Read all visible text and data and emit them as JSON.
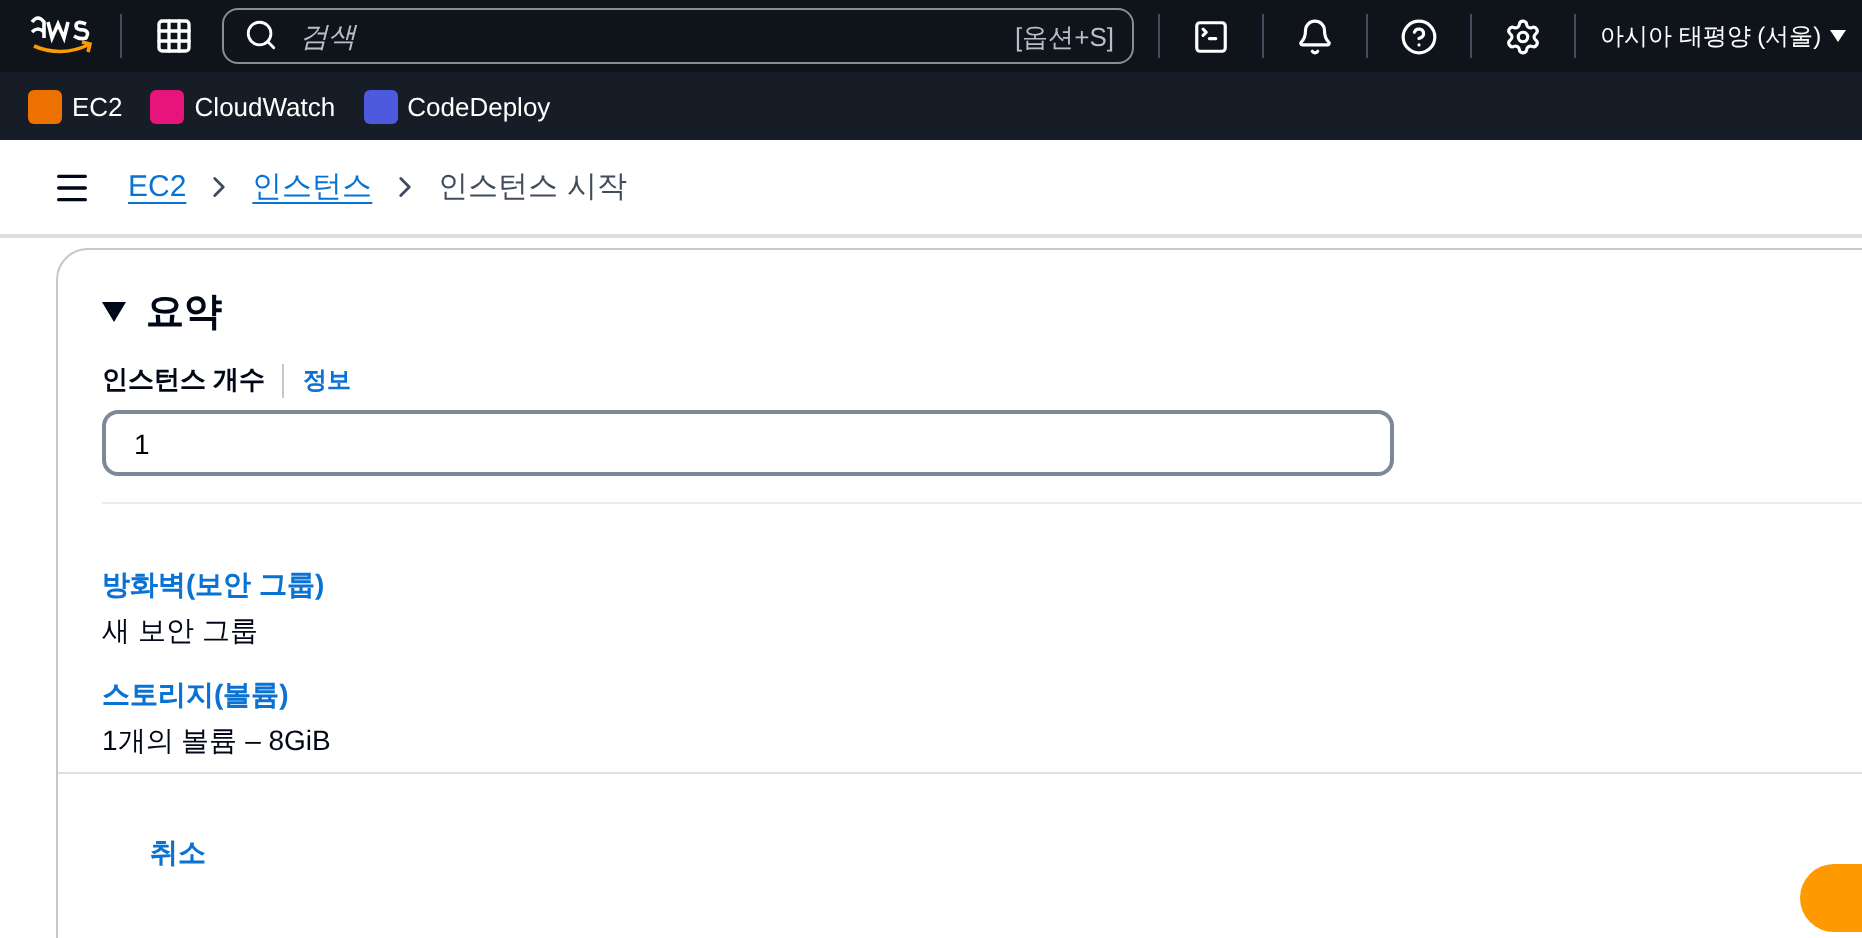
{
  "top_nav": {
    "search": {
      "placeholder": "검색",
      "shortcut": "[옵션+S]"
    },
    "region": "아시아 태평양 (서울)"
  },
  "favorites": [
    {
      "label": "EC2",
      "color": "#ed7100"
    },
    {
      "label": "CloudWatch",
      "color": "#e7157b"
    },
    {
      "label": "CodeDeploy",
      "color": "#4d5ae0"
    }
  ],
  "breadcrumbs": [
    {
      "label": "EC2",
      "link": true
    },
    {
      "label": "인스턴스",
      "link": true
    },
    {
      "label": "인스턴스 시작",
      "link": false
    }
  ],
  "summary": {
    "title": "요약",
    "expanded": true,
    "count_label": "인스턴스 개수",
    "info": "정보",
    "count_value": "1",
    "items": [
      {
        "label": "방화벽(보안 그룹)",
        "value": "새 보안 그룹"
      },
      {
        "label": "스토리지(볼륨)",
        "value": "1개의 볼륨 – 8GiB"
      }
    ],
    "cancel": "취소"
  }
}
